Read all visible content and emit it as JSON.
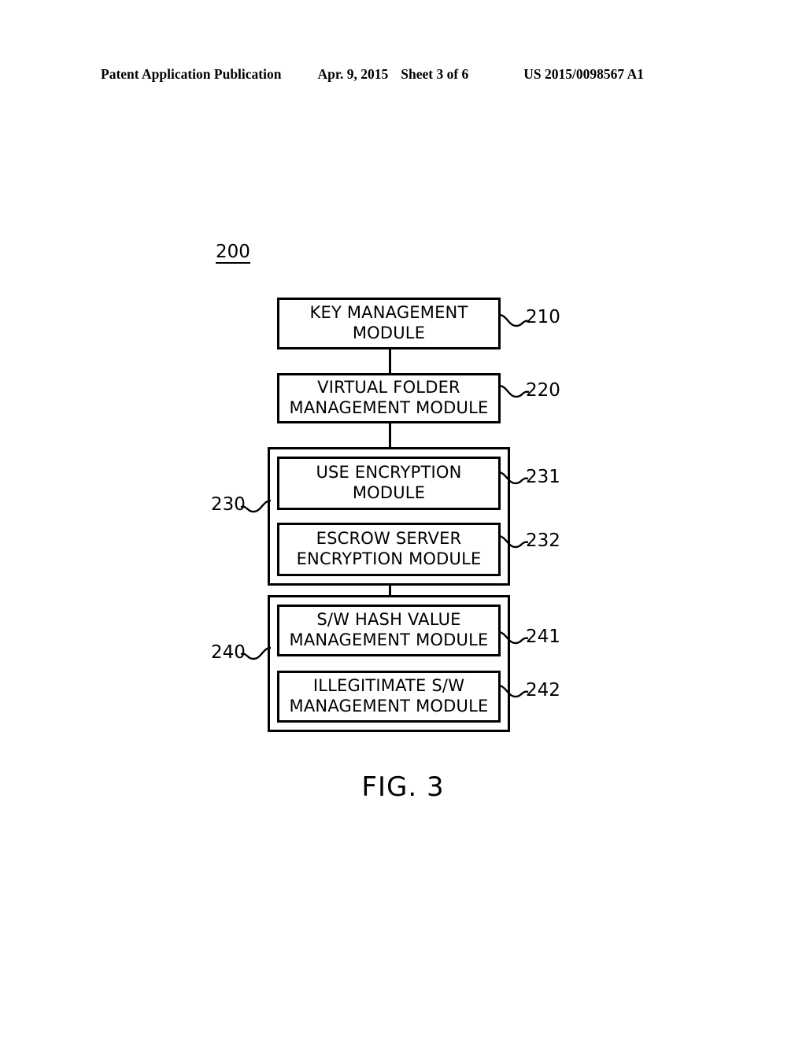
{
  "header": {
    "publication": "Patent Application Publication",
    "date": "Apr. 9, 2015",
    "sheet": "Sheet 3 of 6",
    "document_number": "US 2015/0098567 A1"
  },
  "figure": {
    "caption": "FIG. 3",
    "system_ref": "200",
    "blocks": [
      {
        "id": "210",
        "label": "KEY MANAGEMENT\nMODULE",
        "ref": "210",
        "ref_side": "right"
      },
      {
        "id": "220",
        "label": "VIRTUAL FOLDER\nMANAGEMENT MODULE",
        "ref": "220",
        "ref_side": "right"
      },
      {
        "id": "231",
        "label": "USE ENCRYPTION\nMODULE",
        "ref": "231",
        "ref_side": "right"
      },
      {
        "id": "232",
        "label": "ESCROW SERVER\nENCRYPTION MODULE",
        "ref": "232",
        "ref_side": "right"
      },
      {
        "id": "241",
        "label": "S/W HASH VALUE\nMANAGEMENT MODULE",
        "ref": "241",
        "ref_side": "right"
      },
      {
        "id": "242",
        "label": "ILLEGITIMATE S/W\nMANAGEMENT MODULE",
        "ref": "242",
        "ref_side": "right"
      }
    ],
    "groups": [
      {
        "id": "230",
        "ref": "230",
        "ref_side": "left",
        "children": [
          "231",
          "232"
        ]
      },
      {
        "id": "240",
        "ref": "240",
        "ref_side": "left",
        "children": [
          "241",
          "242"
        ]
      }
    ],
    "connectors": [
      {
        "from": "210",
        "to": "220"
      },
      {
        "from": "220",
        "to": "230"
      },
      {
        "from": "230",
        "to": "240"
      }
    ],
    "line_color": "#000000",
    "background_color": "#ffffff"
  }
}
